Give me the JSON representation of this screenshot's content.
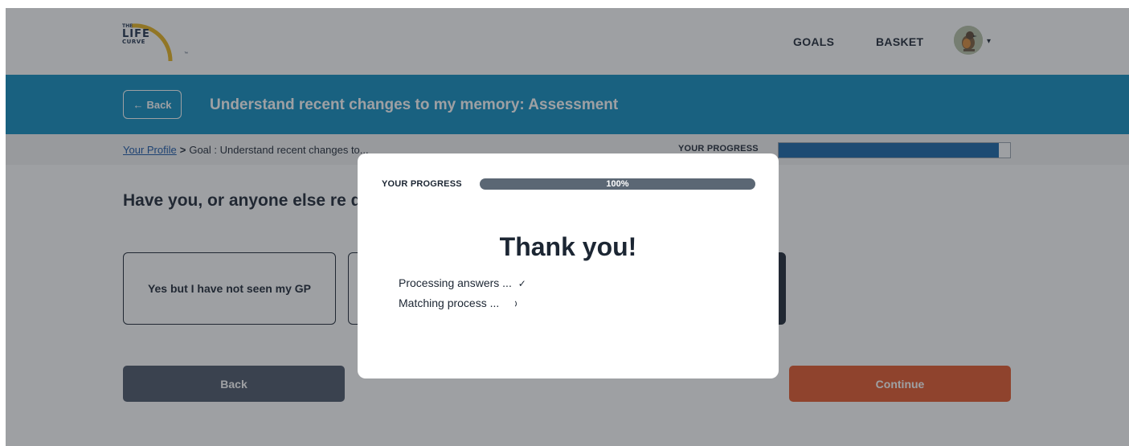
{
  "header": {
    "logo": {
      "line1": "THE",
      "line2": "LIFE",
      "line3": "CURVE",
      "tm": "™"
    },
    "nav": {
      "goals": "GOALS",
      "basket": "BASKET"
    },
    "avatar_caret": "▾"
  },
  "titlebar": {
    "back_label": "Back",
    "back_icon": "←",
    "title": "Understand recent changes to my memory: Assessment"
  },
  "breadcrumb": {
    "link": "Your Profile",
    "separator": ">",
    "current": "Goal : Understand recent changes to..."
  },
  "progress": {
    "label": "YOUR PROGRESS",
    "fraction": 0.95
  },
  "question": {
    "text": "Have you, or anyone else re difficult to understand?",
    "option1": "Yes but I have not seen my GP"
  },
  "actions": {
    "back": "Back",
    "continue": "Continue"
  },
  "modal": {
    "progress_label": "YOUR PROGRESS",
    "progress_value": "100%",
    "progress_fraction": 1.0,
    "title": "Thank you!",
    "step1": "Processing answers ...",
    "step1_status": "✓",
    "step2": "Matching process ..."
  },
  "colors": {
    "brand_blue": "#0e8dc0",
    "progress_blue": "#1565a8",
    "continue_orange": "#e35628",
    "dark_text": "#1c2633",
    "back_gray": "#4a5566"
  }
}
